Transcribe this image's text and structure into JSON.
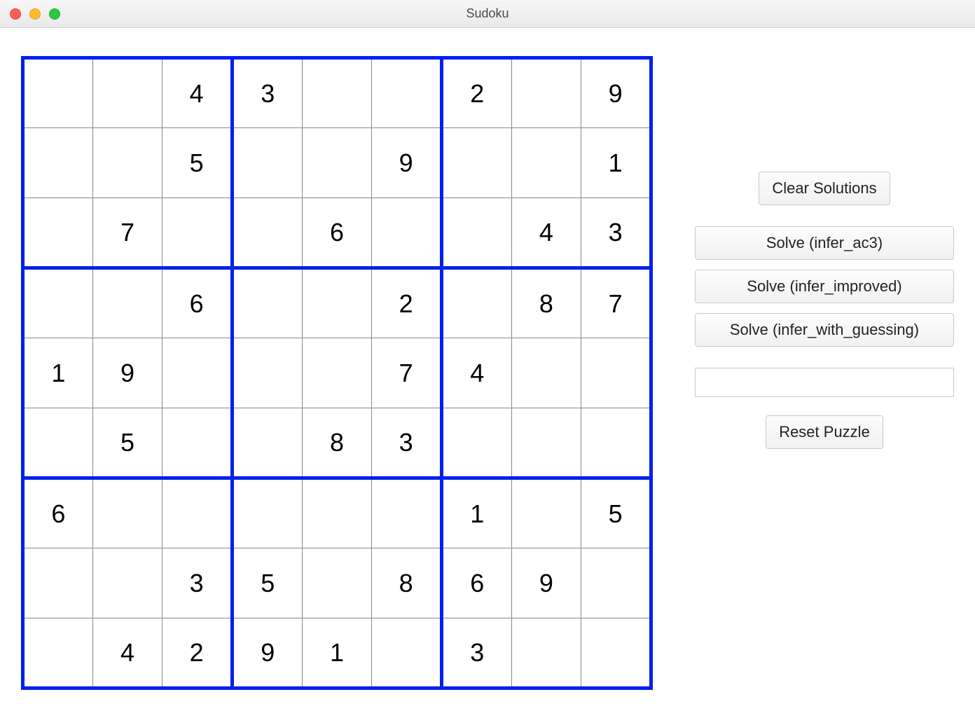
{
  "window": {
    "title": "Sudoku"
  },
  "board": {
    "rows": [
      [
        "",
        "",
        "4",
        "3",
        "",
        "",
        "2",
        "",
        "9"
      ],
      [
        "",
        "",
        "5",
        "",
        "",
        "9",
        "",
        "",
        "1"
      ],
      [
        "",
        "7",
        "",
        "",
        "6",
        "",
        "",
        "4",
        "3"
      ],
      [
        "",
        "",
        "6",
        "",
        "",
        "2",
        "",
        "8",
        "7"
      ],
      [
        "1",
        "9",
        "",
        "",
        "",
        "7",
        "4",
        "",
        ""
      ],
      [
        "",
        "5",
        "",
        "",
        "8",
        "3",
        "",
        "",
        ""
      ],
      [
        "6",
        "",
        "",
        "",
        "",
        "",
        "1",
        "",
        "5"
      ],
      [
        "",
        "",
        "3",
        "5",
        "",
        "8",
        "6",
        "9",
        ""
      ],
      [
        "",
        "4",
        "2",
        "9",
        "1",
        "",
        "3",
        "",
        ""
      ]
    ]
  },
  "controls": {
    "clear_label": "Clear Solutions",
    "solve_ac3_label": "Solve (infer_ac3)",
    "solve_improved_label": "Solve (infer_improved)",
    "solve_guessing_label": "Solve (infer_with_guessing)",
    "reset_label": "Reset Puzzle",
    "input_value": ""
  }
}
